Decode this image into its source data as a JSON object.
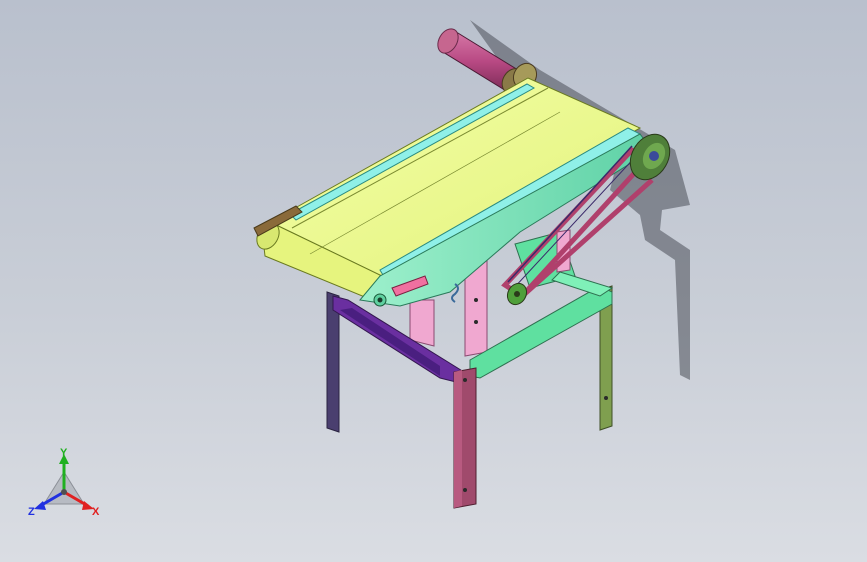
{
  "viewport": {
    "background_top": "#b9c0cd",
    "background_bottom": "#dadde3"
  },
  "model": {
    "parts": [
      {
        "name": "conveyor-belt",
        "color": "#eefc8c"
      },
      {
        "name": "side-frame",
        "color": "#7ee8c0"
      },
      {
        "name": "drive-motor",
        "color": "#c0508c"
      },
      {
        "name": "drive-belt",
        "color": "#b0406c"
      },
      {
        "name": "pulley",
        "color": "#4f9f3a"
      },
      {
        "name": "leg-front",
        "color": "#a04a6c"
      },
      {
        "name": "leg-right",
        "color": "#7f9f4f"
      },
      {
        "name": "leg-left",
        "color": "#4a3f6f"
      },
      {
        "name": "crossbar-purple",
        "color": "#6a2fa0"
      },
      {
        "name": "crossbar-green",
        "color": "#5fe0a0"
      },
      {
        "name": "support-pink",
        "color": "#f0a8d0"
      }
    ]
  },
  "triad": {
    "x_label": "X",
    "y_label": "Y",
    "z_label": "Z",
    "x_color": "#e02020",
    "y_color": "#20b020",
    "z_color": "#2030e0"
  }
}
